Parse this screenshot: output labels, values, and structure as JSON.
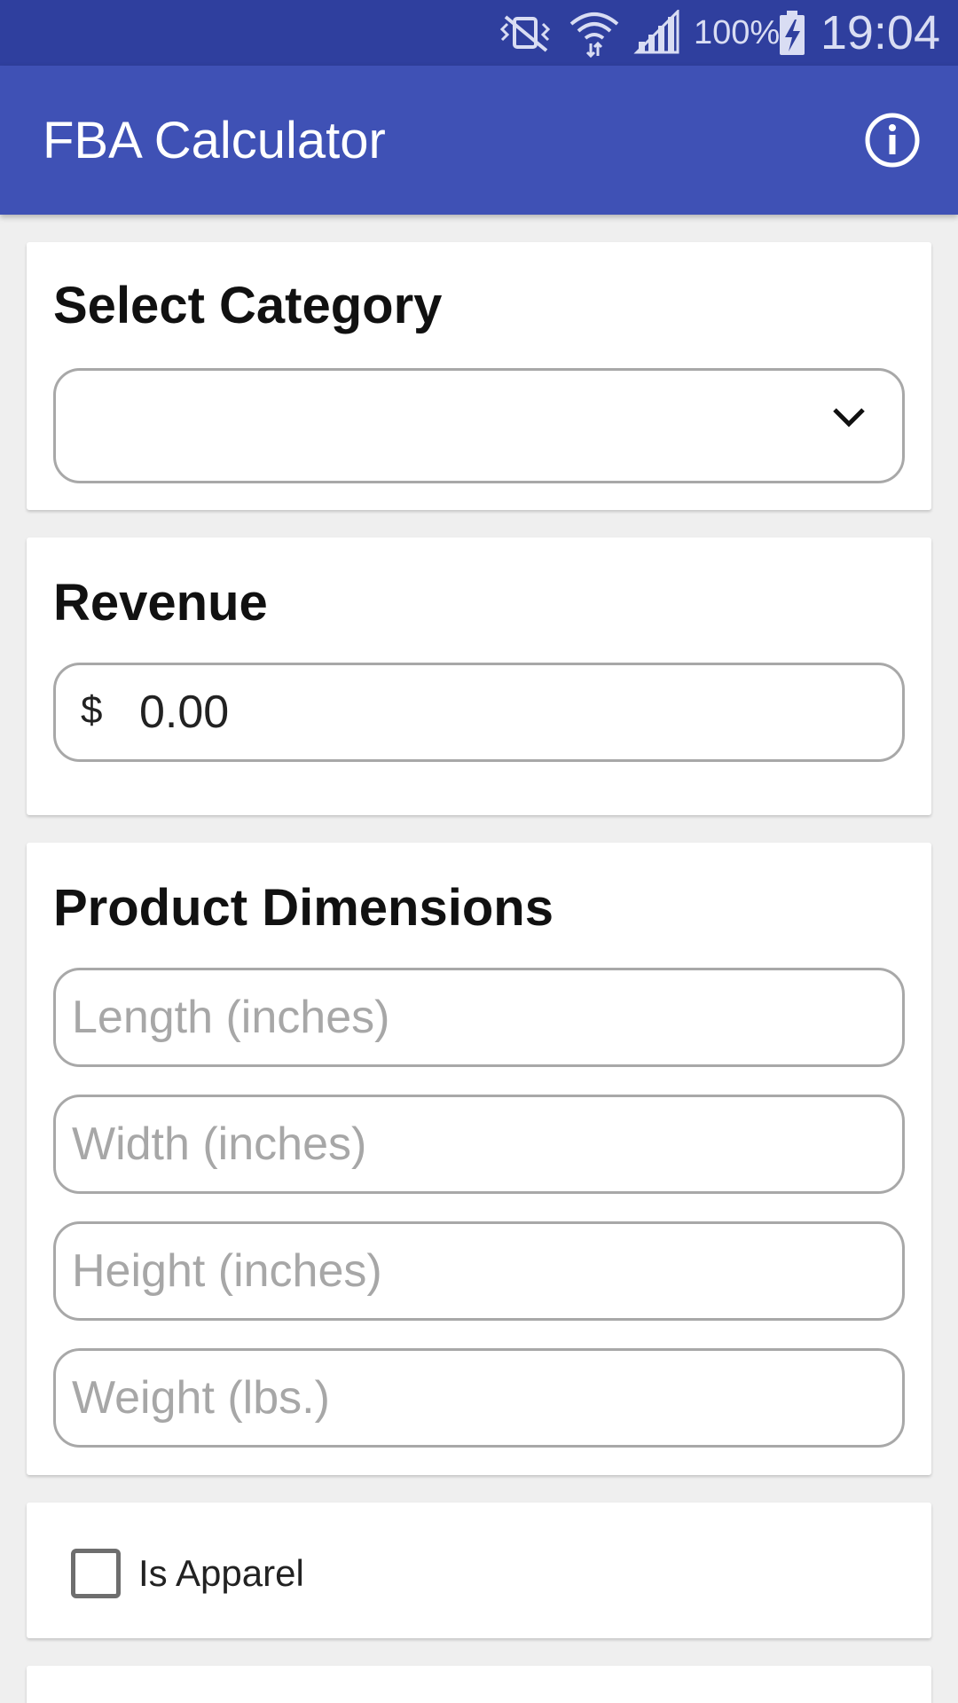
{
  "status_bar": {
    "battery_text": "100%",
    "clock": "19:04",
    "icons": [
      "vibrate-off-icon",
      "wifi-icon",
      "signal-icon",
      "battery-charging-icon"
    ]
  },
  "app_bar": {
    "title": "FBA Calculator",
    "info_icon": "info-icon",
    "color": "#3f51b5"
  },
  "category_card": {
    "title": "Select Category",
    "selected_value": ""
  },
  "revenue_card": {
    "title": "Revenue",
    "currency": "$",
    "value": "0.00"
  },
  "dimensions_card": {
    "title": "Product Dimensions",
    "fields": [
      {
        "placeholder": "Length (inches)",
        "value": ""
      },
      {
        "placeholder": "Width (inches)",
        "value": ""
      },
      {
        "placeholder": "Height (inches)",
        "value": ""
      },
      {
        "placeholder": "Weight (lbs.)",
        "value": ""
      }
    ]
  },
  "apparel_card": {
    "label": "Is Apparel",
    "checked": false
  }
}
